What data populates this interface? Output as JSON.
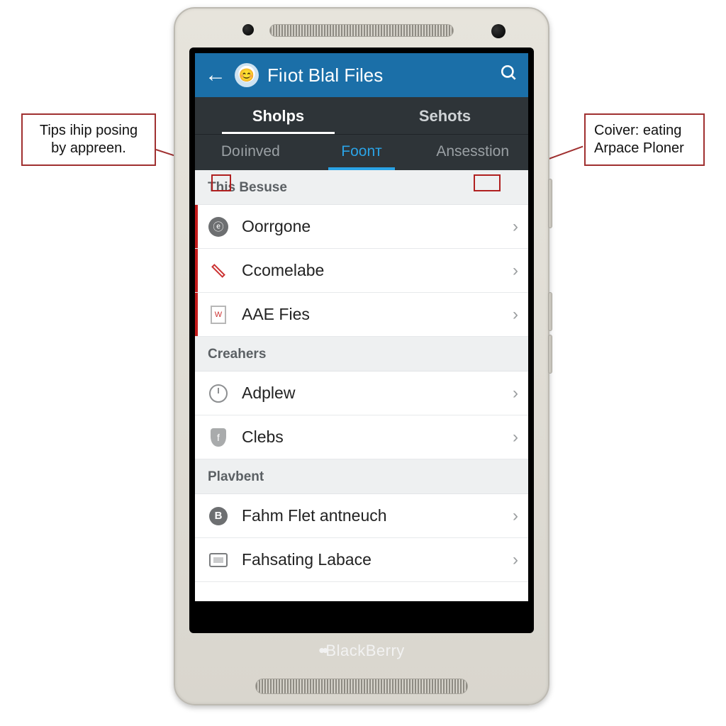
{
  "callouts": {
    "left": "Tips ihip posing by appreen.",
    "right": "Coiver: eating Arpace Ploner"
  },
  "actionbar": {
    "title": "Fiıot Blal Files",
    "logo_glyph": "😊"
  },
  "tabs_upper": [
    {
      "label": "Sholps",
      "active": true
    },
    {
      "label": "Sehots",
      "active": false
    }
  ],
  "tabs_lower": [
    {
      "label": "Doıinved",
      "active": false
    },
    {
      "label": "Foonт",
      "active": true
    },
    {
      "label": "Ansesstion",
      "active": false
    }
  ],
  "sections": [
    {
      "header": "This Besuse",
      "redbar": true,
      "items": [
        {
          "icon": "circle",
          "glyph": "ⓔ",
          "label": "Oorrgone"
        },
        {
          "icon": "pencil",
          "glyph": "",
          "label": "Ccomelabe"
        },
        {
          "icon": "doc",
          "glyph": "W",
          "label": "AAE Fies"
        }
      ]
    },
    {
      "header": "Creahers",
      "redbar": false,
      "items": [
        {
          "icon": "clock",
          "glyph": "",
          "label": "Adplew"
        },
        {
          "icon": "shield",
          "glyph": "f",
          "label": "Clebs"
        }
      ]
    },
    {
      "header": "Plavbent",
      "redbar": false,
      "items": [
        {
          "icon": "b",
          "glyph": "B",
          "label": "Fahm Flet antneuch"
        },
        {
          "icon": "rect",
          "glyph": "",
          "label": "Fahsating Labace"
        }
      ]
    }
  ],
  "brand": "BlackBerry"
}
